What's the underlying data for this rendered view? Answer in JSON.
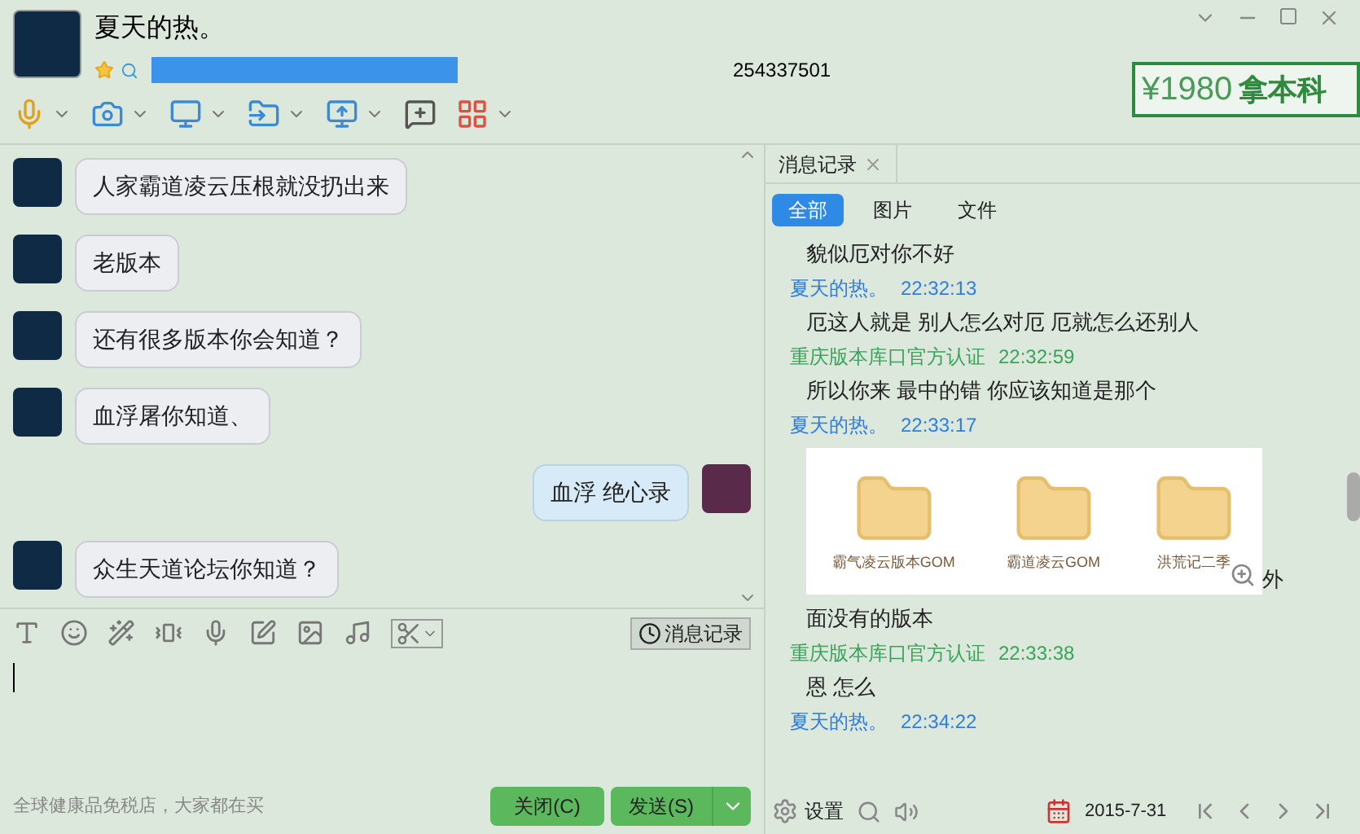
{
  "contact": {
    "name": "夏天的热。",
    "number": "254337501"
  },
  "ad": {
    "price": "¥1980",
    "text": "拿本科"
  },
  "chat": [
    {
      "kind": "received",
      "text": "人家霸道凌云压根就没扔出来"
    },
    {
      "kind": "received",
      "text": "老版本"
    },
    {
      "kind": "received",
      "text": "还有很多版本你会知道？"
    },
    {
      "kind": "received",
      "text": "血浮屠你知道、"
    },
    {
      "kind": "sent",
      "text": "血浮  绝心录"
    },
    {
      "kind": "received",
      "text": "众生天道论坛你知道？"
    }
  ],
  "compose": {
    "history_button": "消息记录",
    "footer_ad": "全球健康品免税店，大家都在买",
    "buttons": [
      "关闭(C)",
      "发送(S)"
    ]
  },
  "history": {
    "tab": "消息记录",
    "filters": [
      {
        "label": "全部",
        "selected": true
      },
      {
        "label": "图片",
        "selected": false
      },
      {
        "label": "文件",
        "selected": false
      }
    ],
    "entries": [
      {
        "kind": "message",
        "text": "貌似厄对你不好"
      },
      {
        "kind": "meta",
        "sender": "夏天的热。",
        "time": "22:32:13",
        "color": "#2f7de1"
      },
      {
        "kind": "message",
        "text": "厄这人就是 别人怎么对厄 厄就怎么还别人"
      },
      {
        "kind": "meta",
        "sender": "重庆版本库口官方认证",
        "time": "22:32:59",
        "color": "#3aa35a"
      },
      {
        "kind": "message",
        "text": "所以你来  最中的错 你应该知道是那个"
      },
      {
        "kind": "meta",
        "sender": "夏天的热。",
        "time": "22:33:17",
        "color": "#2f7de1"
      },
      {
        "kind": "image",
        "folders": [
          "霸气凌云版本GOM",
          "霸道凌云GOM",
          "洪荒记二季"
        ],
        "after": "外"
      },
      {
        "kind": "message",
        "text": "面没有的版本"
      },
      {
        "kind": "meta",
        "sender": "重庆版本库口官方认证",
        "time": "22:33:38",
        "color": "#3aa35a"
      },
      {
        "kind": "message",
        "text": "恩  怎么"
      },
      {
        "kind": "meta",
        "sender": "夏天的热。",
        "time": "22:34:22",
        "color": "#2f7de1"
      }
    ],
    "settings": "设置",
    "date": "2015-7-31"
  }
}
